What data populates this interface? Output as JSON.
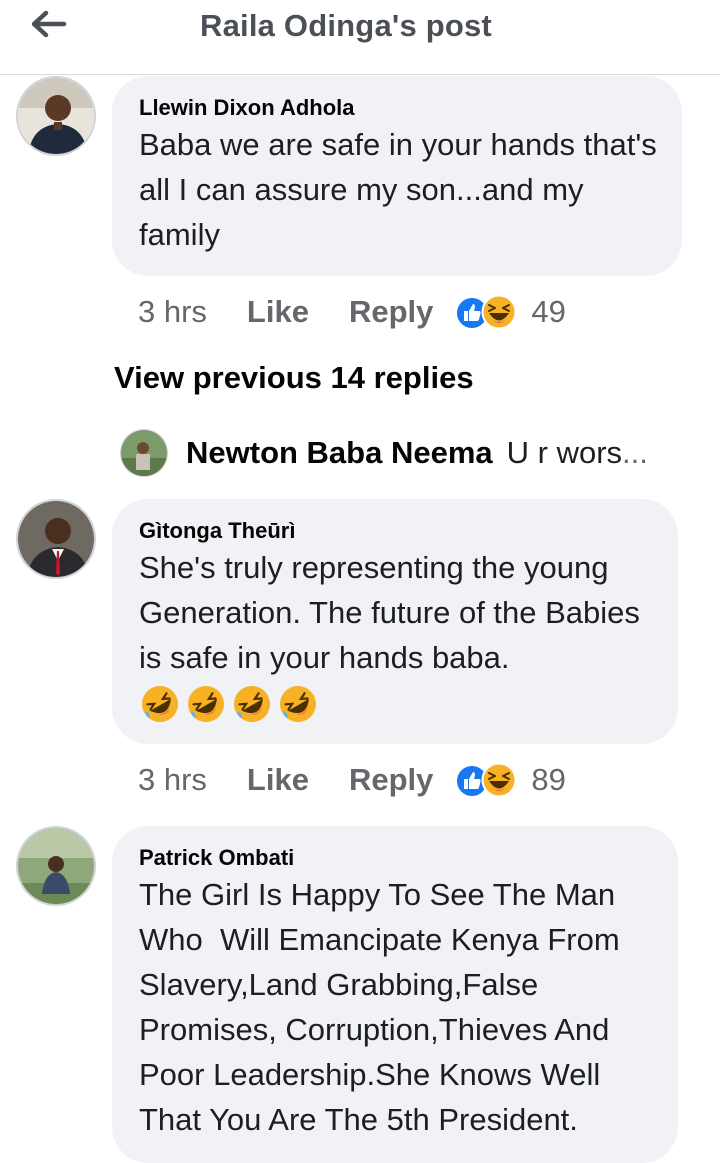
{
  "header": {
    "title": "Raila Odinga's post"
  },
  "comments": [
    {
      "author": "Llewin Dixon Adhola",
      "text": "Baba we are safe in your hands that's all I can assure my son...and my family",
      "time": "3 hrs",
      "like_label": "Like",
      "reply_label": "Reply",
      "reaction_count": "49"
    },
    {
      "author": "Gìtonga Theūrì",
      "text": "She's truly representing the young Generation. The future of the Babies is safe in your hands baba.",
      "emoji": [
        "rolling-on-floor-laughing",
        "rolling-on-floor-laughing",
        "rolling-on-floor-laughing",
        "rolling-on-floor-laughing"
      ],
      "time": "3 hrs",
      "like_label": "Like",
      "reply_label": "Reply",
      "reaction_count": "89"
    },
    {
      "author": "Patrick Ombati",
      "text": "The Girl Is Happy To See The Man Who  Will Emancipate Kenya From Slavery,Land Grabbing,False Promises, Corruption,Thieves And Poor Leadership.She Knows Well That You Are The 5th President."
    }
  ],
  "view_previous": "View previous 14 replies",
  "reply_preview": {
    "author": "Newton Baba Neema",
    "snippet": "U r wors",
    "ellipsis": "..."
  },
  "colors": {
    "bubble": "#f0f2f5",
    "like_blue": "#1877f2",
    "haha_yellow": "#f7b125",
    "muted": "#65676b"
  },
  "icons": [
    "back-arrow-icon",
    "like-reaction-icon",
    "haha-reaction-icon",
    "rolling-on-floor-laughing-emoji"
  ]
}
